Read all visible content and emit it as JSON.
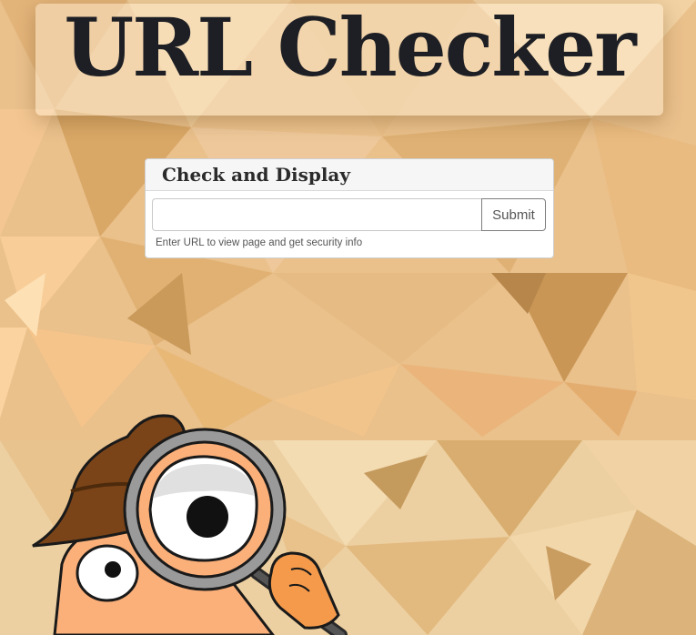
{
  "header": {
    "title": "URL Checker"
  },
  "check_card": {
    "title": "Check and Display",
    "input_value": "",
    "input_placeholder": "",
    "submit_label": "Submit",
    "help_text": "Enter URL to view page and get security info"
  },
  "illustration": {
    "icon": "detective-magnifying-glass-icon"
  },
  "colors": {
    "background": "#ebc089",
    "title_text": "#1e1f24",
    "card_header_bg": "#f6f6f6",
    "detective_skin": "#fbb07a",
    "detective_hat": "#7a4418",
    "magnifier_frame": "#9a9a9a"
  }
}
